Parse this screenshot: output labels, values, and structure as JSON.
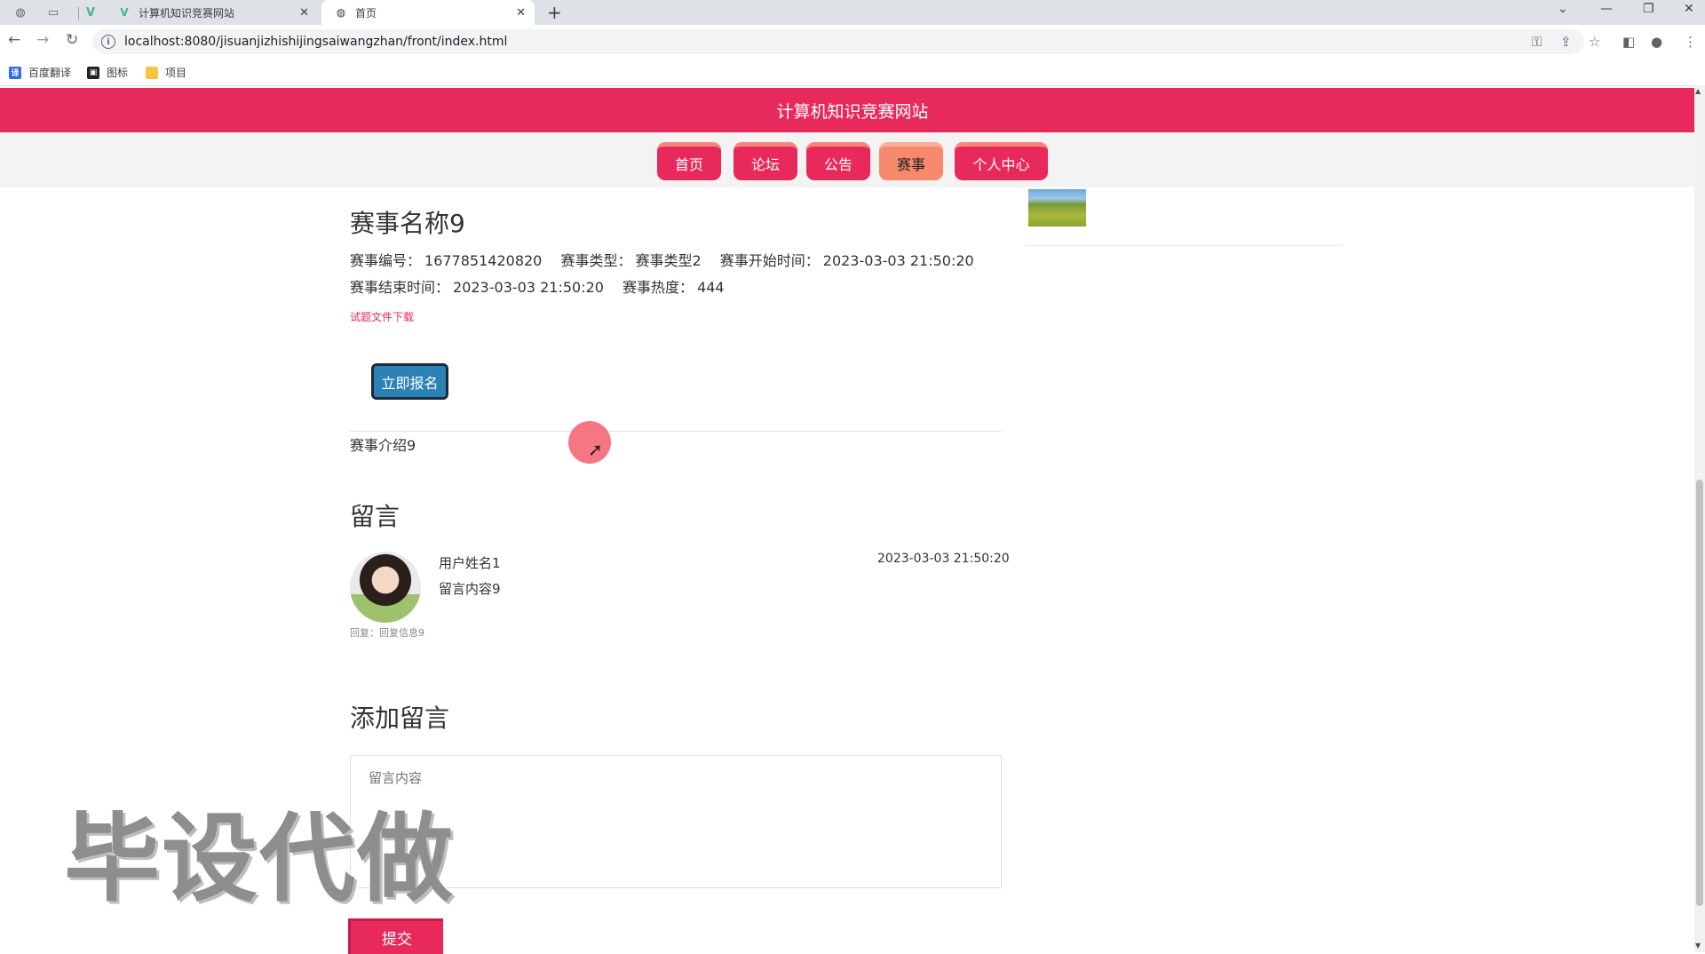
{
  "browser": {
    "tabs": [
      {
        "title": "计算机知识竞赛网站",
        "icon": "vue-logo-icon"
      },
      {
        "title": "首页",
        "icon": "globe-icon"
      }
    ],
    "url": "localhost:8080/jisuanjizhishijingsaiwangzhan/front/index.html",
    "bookmarks": [
      {
        "label": "百度翻译",
        "icon": "translate-icon"
      },
      {
        "label": "图标",
        "icon": "image-icon"
      },
      {
        "label": "项目",
        "icon": "folder-icon"
      }
    ]
  },
  "site": {
    "title": "计算机知识竞赛网站",
    "nav": [
      {
        "label": "首页"
      },
      {
        "label": "论坛"
      },
      {
        "label": "公告"
      },
      {
        "label": "赛事",
        "active": true
      },
      {
        "label": "个人中心"
      }
    ]
  },
  "event": {
    "name": "赛事名称9",
    "number_label": "赛事编号：",
    "number": "1677851420820",
    "type_label": "赛事类型：",
    "type": "赛事类型2",
    "start_label": "赛事开始时间：",
    "start": "2023-03-03 21:50:20",
    "end_label": "赛事结束时间：",
    "end": "2023-03-03 21:50:20",
    "heat_label": "赛事热度：",
    "heat": "444",
    "download_link": "试题文件下载",
    "signup_button": "立即报名",
    "intro": "赛事介绍9"
  },
  "comments": {
    "heading": "留言",
    "items": [
      {
        "user": "用户姓名1",
        "text": "留言内容9",
        "time": "2023-03-03 21:50:20",
        "reply": "回复：回复信息9"
      }
    ]
  },
  "add_comment": {
    "heading": "添加留言",
    "placeholder": "留言内容",
    "submit": "提交"
  },
  "overlay": {
    "watermark": "毕设代做"
  },
  "colors": {
    "brand": "#e8295b",
    "nav_active": "#f7896f",
    "signup": "#2d82b5"
  }
}
